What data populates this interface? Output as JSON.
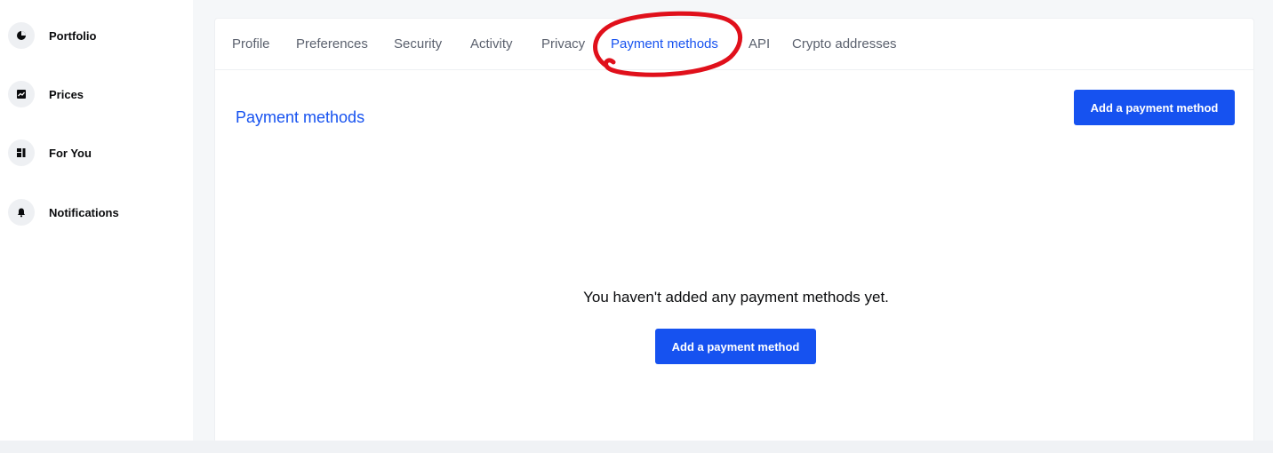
{
  "sidebar": {
    "items": [
      {
        "label": "Portfolio",
        "icon": "pie-chart-icon"
      },
      {
        "label": "Prices",
        "icon": "line-chart-icon"
      },
      {
        "label": "For You",
        "icon": "grid-icon"
      },
      {
        "label": "Notifications",
        "icon": "bell-icon"
      }
    ]
  },
  "tabs": [
    {
      "label": "Profile",
      "active": false
    },
    {
      "label": "Preferences",
      "active": false
    },
    {
      "label": "Security",
      "active": false
    },
    {
      "label": "Activity",
      "active": false
    },
    {
      "label": "Privacy",
      "active": false
    },
    {
      "label": "Payment methods",
      "active": true
    },
    {
      "label": "API",
      "active": false
    },
    {
      "label": "Crypto addresses",
      "active": false
    }
  ],
  "main": {
    "section_title": "Payment methods",
    "add_button_label": "Add a payment method",
    "empty_message": "You haven't added any payment methods yet.",
    "empty_add_button_label": "Add a payment method"
  },
  "colors": {
    "accent": "#1652f0",
    "annotation": "#e0101b",
    "muted_text": "#5b616e"
  }
}
